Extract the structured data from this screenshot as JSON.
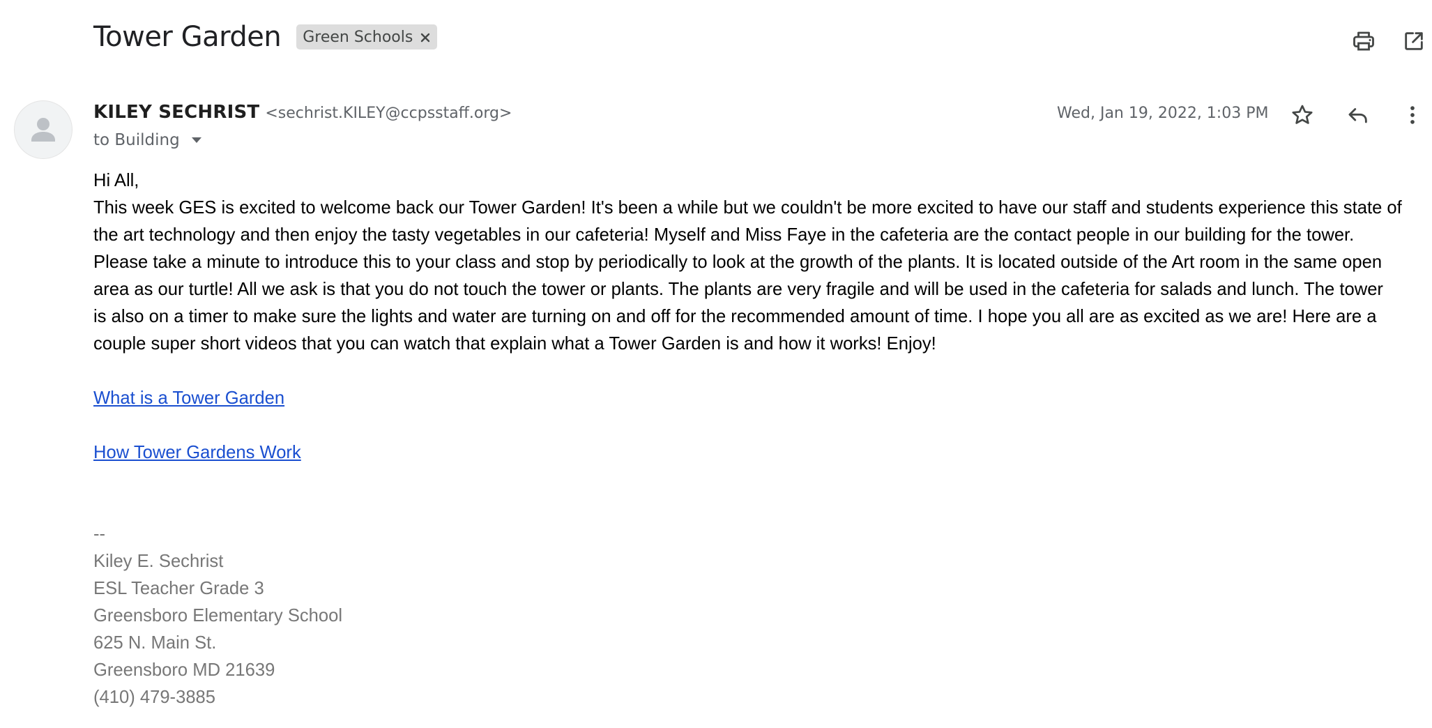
{
  "email": {
    "subject": "Tower Garden",
    "label": "Green Schools",
    "sender_name": "KILEY SECHRIST",
    "sender_email": "<sechrist.KILEY@ccpsstaff.org>",
    "recipient": "to Building",
    "date": "Wed, Jan 19, 2022, 1:03 PM",
    "greeting": "Hi All,",
    "body_lines": [
      "This week GES is excited to welcome back our Tower Garden!  It's been a while but we couldn't be more excited to have our staff and students experience this state of",
      "the art technology and then enjoy the tasty vegetables in our cafeteria!  Myself and Miss Faye in the cafeteria are the contact people in our building for the tower.",
      "Please take a minute to introduce this to your class and stop by periodically to look at the growth of the plants.  It is located outside of the Art room in the same open",
      "area as our turtle!  All we ask is that you do not touch the tower or plants.  The plants are very fragile and will be used in the cafeteria for salads and lunch. The tower",
      "is also on a timer to make sure the lights and water are turning on and off for the recommended amount of time. I hope you all are as excited as we are! Here are a",
      "couple super short videos that you can watch that explain what a Tower Garden is and how it works! Enjoy!"
    ],
    "links": [
      "What is a Tower Garden",
      "How Tower Gardens Work"
    ],
    "signature": {
      "separator": "--",
      "name": "Kiley E. Sechrist",
      "title": "ESL Teacher Grade 3",
      "school": "Greensboro Elementary School",
      "street": "625 N. Main St.",
      "city": "Greensboro MD 21639",
      "phone": "(410) 479-3885"
    }
  },
  "icons": {
    "print": "print-icon",
    "open_new_window": "open-in-new-window-icon",
    "star": "star-icon",
    "reply": "reply-icon",
    "more": "more-vertical-icon",
    "avatar": "person-icon",
    "label_remove": "close-icon",
    "details": "caret-down-icon"
  },
  "colors": {
    "link": "#1a4fd0",
    "signature": "#777777",
    "chip_background": "#dddddd",
    "icon": "#444746"
  }
}
